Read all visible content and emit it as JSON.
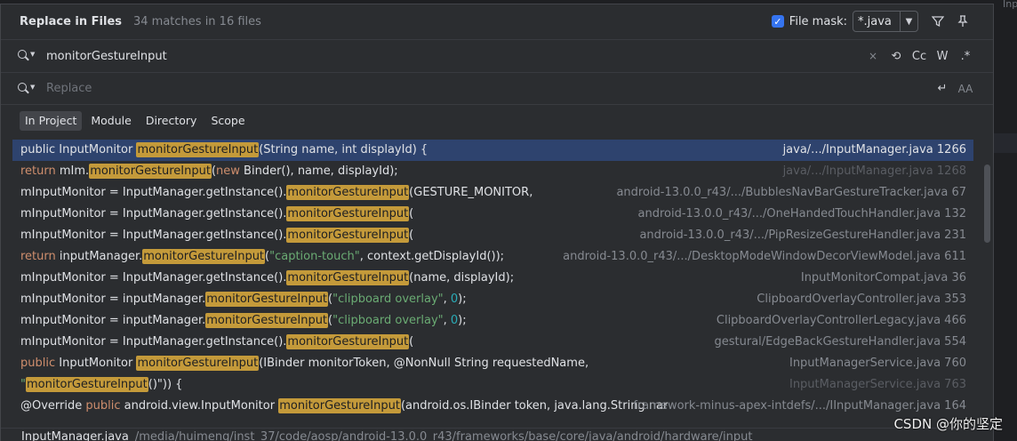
{
  "dialog": {
    "title": "Replace in Files",
    "subtitle": "34 matches in 16 files",
    "file_mask_label": "File mask:",
    "file_mask_value": "*.java",
    "file_mask_checked": true,
    "filter_icon": "filter-icon",
    "pin_icon": "pin-icon"
  },
  "search": {
    "value": "monitorGestureInput",
    "options": [
      "×",
      "⟲",
      "Cc",
      "W",
      ".*"
    ]
  },
  "replace": {
    "placeholder": "Replace",
    "options": [
      "↵",
      "AA"
    ]
  },
  "scopes": [
    {
      "label": "In Project",
      "active": true
    },
    {
      "label": "Module",
      "active": false
    },
    {
      "label": "Directory",
      "active": false
    },
    {
      "label": "Scope",
      "active": false
    }
  ],
  "match": "monitorGestureInput",
  "results": [
    {
      "pre": [
        {
          "t": "public InputMonitor ",
          "c": ""
        }
      ],
      "post": [
        {
          "t": "(String name, int displayId) {",
          "c": ""
        }
      ],
      "loc": "java/.../InputManager.java 1266",
      "selected": true,
      "dim": false
    },
    {
      "pre": [
        {
          "t": "return ",
          "c": "kw"
        },
        {
          "t": "mIm.",
          "c": ""
        }
      ],
      "post": [
        {
          "t": "(",
          "c": ""
        },
        {
          "t": "new ",
          "c": "kw"
        },
        {
          "t": "Binder(), name, displayId);",
          "c": ""
        }
      ],
      "loc": "java/.../InputManager.java 1268",
      "selected": false,
      "dim": true
    },
    {
      "pre": [
        {
          "t": "mInputMonitor = InputManager.getInstance().",
          "c": ""
        }
      ],
      "post": [
        {
          "t": "(GESTURE_MONITOR,",
          "c": ""
        }
      ],
      "loc": "android-13.0.0_r43/.../BubblesNavBarGestureTracker.java 67",
      "selected": false,
      "dim": false
    },
    {
      "pre": [
        {
          "t": "mInputMonitor = InputManager.getInstance().",
          "c": ""
        }
      ],
      "post": [
        {
          "t": "(",
          "c": ""
        }
      ],
      "loc": "android-13.0.0_r43/.../OneHandedTouchHandler.java 132",
      "selected": false,
      "dim": false
    },
    {
      "pre": [
        {
          "t": "mInputMonitor = InputManager.getInstance().",
          "c": ""
        }
      ],
      "post": [
        {
          "t": "(",
          "c": ""
        }
      ],
      "loc": "android-13.0.0_r43/.../PipResizeGestureHandler.java 231",
      "selected": false,
      "dim": false
    },
    {
      "pre": [
        {
          "t": "return ",
          "c": "kw"
        },
        {
          "t": "inputManager.",
          "c": ""
        }
      ],
      "post": [
        {
          "t": "(",
          "c": ""
        },
        {
          "t": "\"caption-touch\"",
          "c": "str"
        },
        {
          "t": ", context.getDisplayId());",
          "c": ""
        }
      ],
      "loc": "android-13.0.0_r43/.../DesktopModeWindowDecorViewModel.java 611",
      "selected": false,
      "dim": false
    },
    {
      "pre": [
        {
          "t": "mInputMonitor = InputManager.getInstance().",
          "c": ""
        }
      ],
      "post": [
        {
          "t": "(name, displayId);",
          "c": ""
        }
      ],
      "loc": "InputMonitorCompat.java 36",
      "selected": false,
      "dim": false
    },
    {
      "pre": [
        {
          "t": "mInputMonitor = inputManager.",
          "c": ""
        }
      ],
      "post": [
        {
          "t": "(",
          "c": ""
        },
        {
          "t": "\"clipboard overlay\"",
          "c": "str"
        },
        {
          "t": ", ",
          "c": ""
        },
        {
          "t": "0",
          "c": "num"
        },
        {
          "t": ");",
          "c": ""
        }
      ],
      "loc": "ClipboardOverlayController.java 353",
      "selected": false,
      "dim": false
    },
    {
      "pre": [
        {
          "t": "mInputMonitor = inputManager.",
          "c": ""
        }
      ],
      "post": [
        {
          "t": "(",
          "c": ""
        },
        {
          "t": "\"clipboard overlay\"",
          "c": "str"
        },
        {
          "t": ", ",
          "c": ""
        },
        {
          "t": "0",
          "c": "num"
        },
        {
          "t": ");",
          "c": ""
        }
      ],
      "loc": "ClipboardOverlayControllerLegacy.java 466",
      "selected": false,
      "dim": false
    },
    {
      "pre": [
        {
          "t": "mInputMonitor = InputManager.getInstance().",
          "c": ""
        }
      ],
      "post": [
        {
          "t": "(",
          "c": ""
        }
      ],
      "loc": "gestural/EdgeBackGestureHandler.java 554",
      "selected": false,
      "dim": false
    },
    {
      "pre": [
        {
          "t": "public ",
          "c": "kw"
        },
        {
          "t": "InputMonitor ",
          "c": ""
        }
      ],
      "post": [
        {
          "t": "(IBinder monitorToken, @NonNull String requestedName,",
          "c": ""
        }
      ],
      "loc": "InputManagerService.java 760",
      "selected": false,
      "dim": false
    },
    {
      "pre": [
        {
          "t": "\"",
          "c": "str"
        }
      ],
      "post": [
        {
          "t": "()\")) {",
          "c": ""
        }
      ],
      "loc": "InputManagerService.java 763",
      "selected": false,
      "dim": true
    },
    {
      "pre": [
        {
          "t": "@Override ",
          "c": ""
        },
        {
          "t": "public ",
          "c": "kw"
        },
        {
          "t": "android.view.InputMonitor ",
          "c": ""
        }
      ],
      "post": [
        {
          "t": "(android.os.IBinder token, java.lang.String nar",
          "c": ""
        }
      ],
      "loc": "framework-minus-apex-intdefs/.../IInputManager.java 164",
      "selected": false,
      "dim": false
    }
  ],
  "footer": {
    "file_name": "InputManager.java",
    "file_path": "/media/huimeng/inst_37/code/aosp/android-13.0.0_r43/frameworks/base/core/java/android/hardware/input"
  },
  "watermark": "CSDN @你的坚定",
  "edge_text": "Inpu"
}
